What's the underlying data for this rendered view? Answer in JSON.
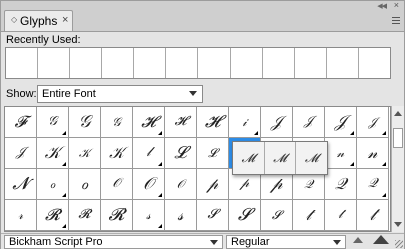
{
  "tab": {
    "title": "Glyphs",
    "close": "×"
  },
  "recent": {
    "label": "Recently Used:",
    "slots": 12
  },
  "show": {
    "label": "Show:",
    "value": "Entire Font"
  },
  "glyphs": {
    "rows": [
      [
        "𝓕",
        "𝒢",
        "𝒢",
        "𝒢",
        "𝓗",
        "𝓗",
        "𝓗",
        "𝒾",
        "𝒥",
        "𝒥",
        "𝒥",
        "𝒥"
      ],
      [
        "𝒥",
        "𝒦",
        "𝒦",
        "𝒦",
        "𝓁",
        "𝓛",
        "𝓛",
        "𝓜",
        "𝓜",
        "𝓜",
        "𝓃",
        "𝓃"
      ],
      [
        "𝓝",
        "ℴ",
        "ℴ",
        "𝒪",
        "𝒪",
        "𝒪",
        "𝓅",
        "𝓅",
        "𝓅",
        "𝒬",
        "𝒬",
        "𝒬"
      ],
      [
        "𝓇",
        "𝓡",
        "𝓡",
        "𝓡",
        "𝓈",
        "𝓈",
        "𝓢",
        "𝓢",
        "𝓢",
        "𝓉",
        "𝓉",
        "𝓉"
      ]
    ],
    "has_alternates": [
      [
        false,
        true,
        false,
        false,
        true,
        false,
        false,
        true,
        false,
        false,
        true,
        true
      ],
      [
        false,
        true,
        false,
        false,
        true,
        false,
        false,
        true,
        false,
        false,
        true,
        true
      ],
      [
        false,
        true,
        false,
        false,
        true,
        false,
        false,
        false,
        false,
        false,
        false,
        true
      ],
      [
        false,
        true,
        false,
        false,
        true,
        false,
        false,
        false,
        false,
        false,
        false,
        false
      ]
    ],
    "selected": {
      "row": 1,
      "col": 7
    },
    "popup": [
      "𝓜",
      "𝓜",
      "𝓜"
    ]
  },
  "footer": {
    "font_name": "Bickham Script Pro",
    "font_style": "Regular"
  }
}
